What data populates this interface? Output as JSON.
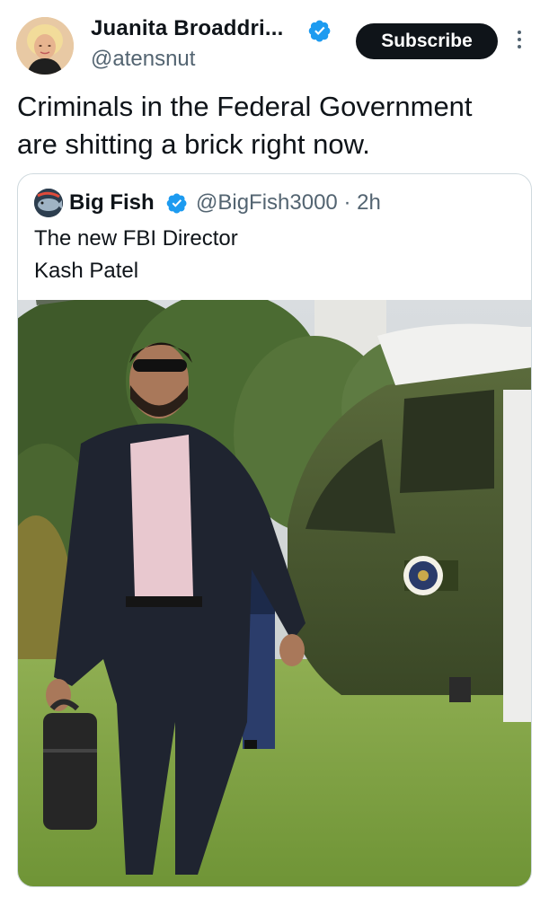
{
  "author": {
    "name": "Juanita Broaddri...",
    "handle": "@atensnut"
  },
  "subscribe_label": "Subscribe",
  "tweet": {
    "line1": "Criminals in the Federal Government",
    "line2": "are shitting a brick right now."
  },
  "quoted": {
    "name": "Big Fish",
    "handle": "@BigFish3000",
    "separator": "·",
    "time": "2h",
    "line1": "The new FBI Director",
    "line2": "Kash Patel"
  },
  "icons": {
    "verified": "verified-badge-icon",
    "more": "more-options-icon"
  },
  "colors": {
    "verified_blue": "#1d9bf0",
    "subscribe_bg": "#0f1419",
    "secondary_text": "#536471",
    "border": "#cfd9de"
  }
}
